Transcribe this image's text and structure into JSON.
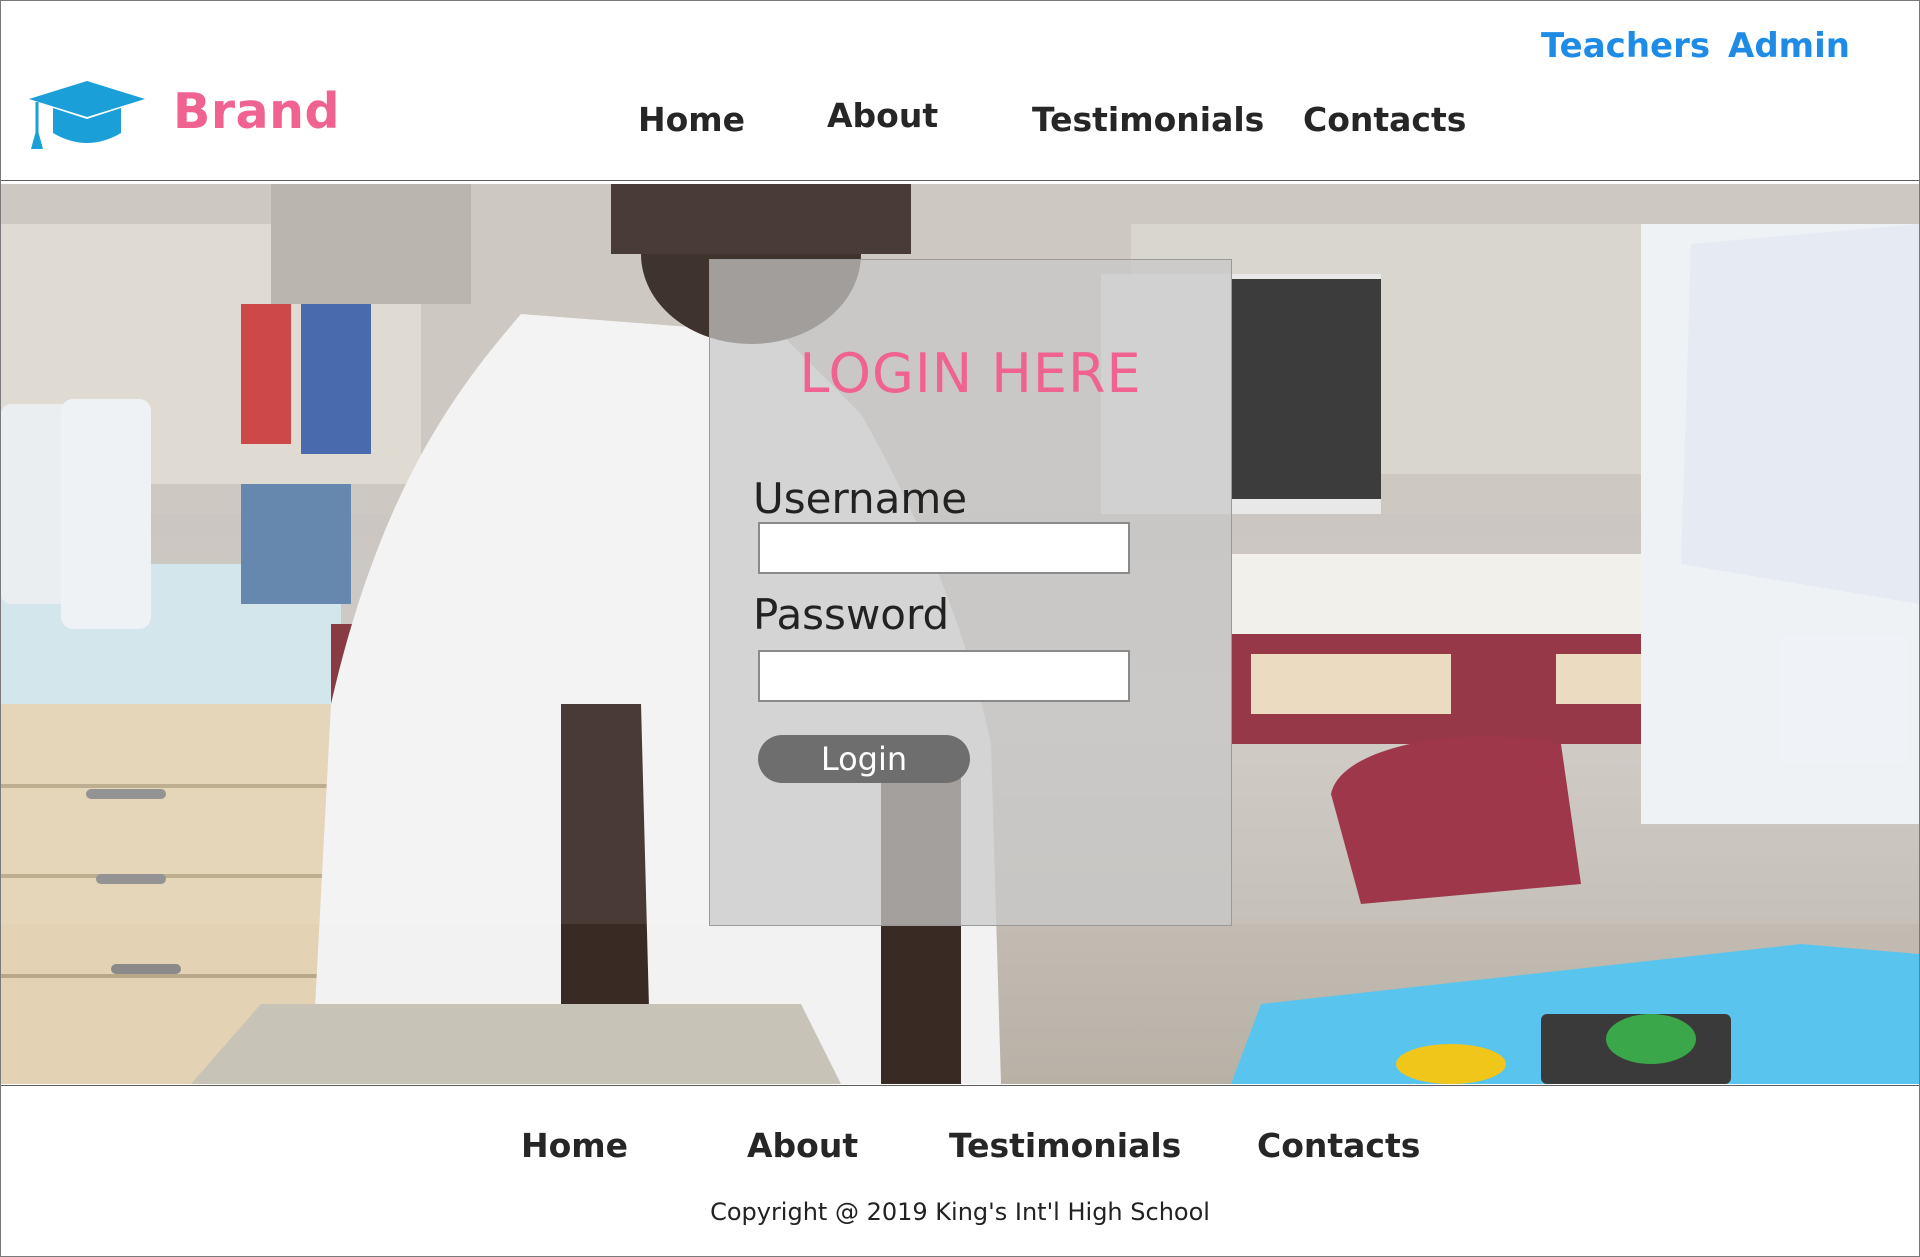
{
  "header": {
    "brand": "Brand",
    "top_links": {
      "teachers": "Teachers",
      "admin": "Admin"
    },
    "nav": {
      "home": "Home",
      "about": "About",
      "testimonials": "Testimonials",
      "contacts": "Contacts"
    },
    "logo_icon": "graduation-cap-icon"
  },
  "login": {
    "title": "LOGIN HERE",
    "username_label": "Username",
    "username_value": "",
    "password_label": "Password",
    "password_value": "",
    "button_label": "Login"
  },
  "footer": {
    "nav": {
      "home": "Home",
      "about": "About",
      "testimonials": "Testimonials",
      "contacts": "Contacts"
    },
    "copyright": "Copyright @ 2019 King's Int'l High School"
  },
  "colors": {
    "brand": "#f0628f",
    "link_blue": "#1e8ce6",
    "logo_blue": "#1a9fd9",
    "login_button": "#6e6e6e"
  }
}
